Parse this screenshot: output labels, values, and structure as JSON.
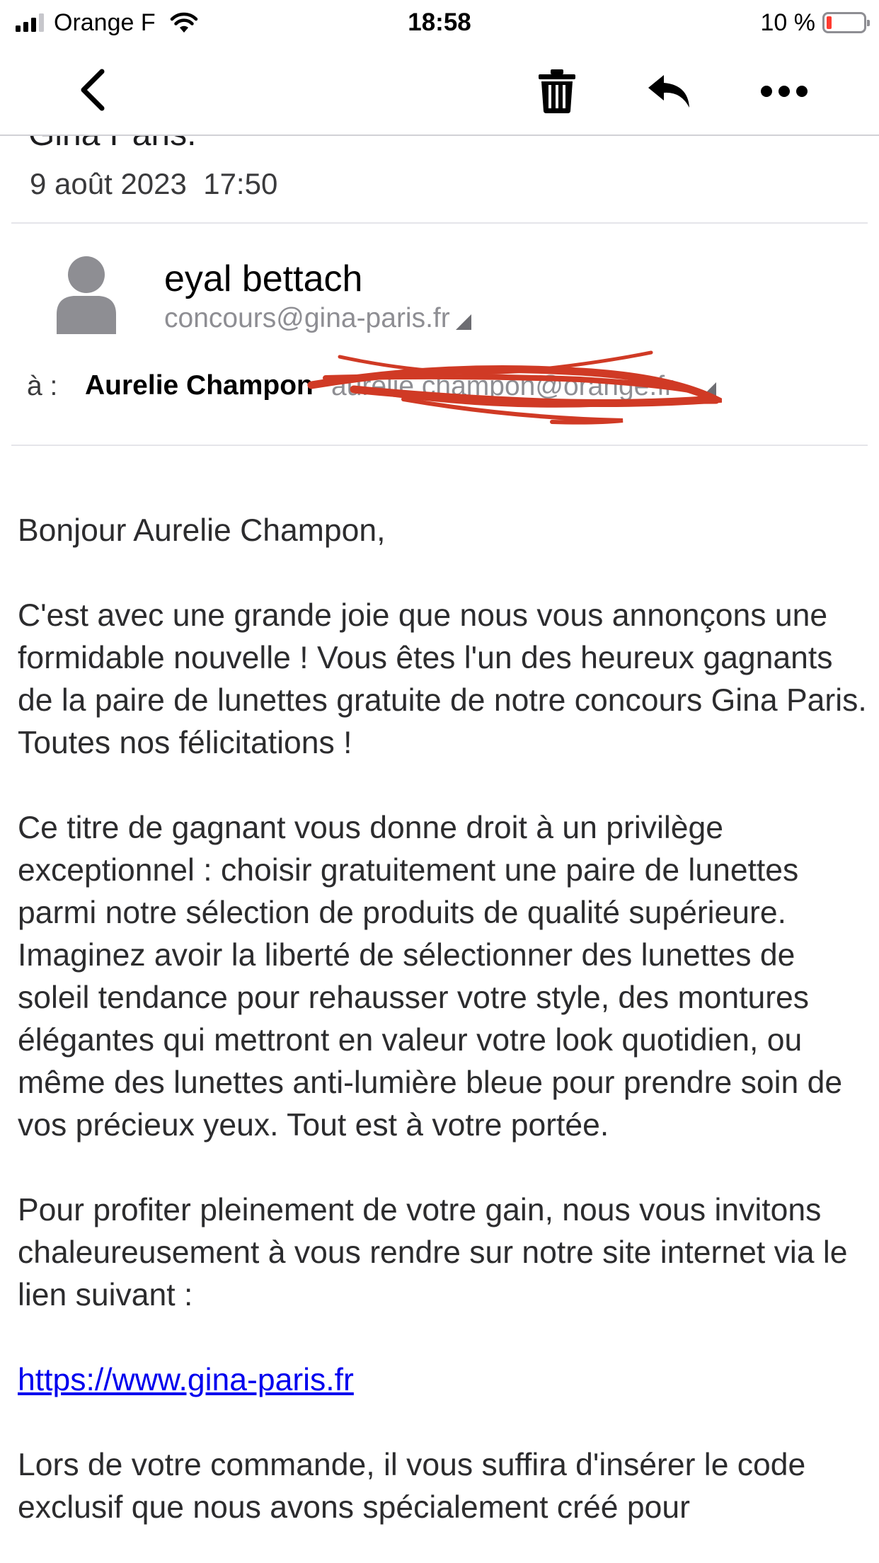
{
  "status_bar": {
    "carrier": "Orange F",
    "time": "18:58",
    "battery_percent": "10 %",
    "battery_level": 0.1,
    "signal_bars": 3,
    "signal_bars_total": 4
  },
  "toolbar": {
    "back_icon": "chevron-left-icon",
    "trash_icon": "trash-icon",
    "reply_icon": "reply-icon",
    "more_icon": "more-horizontal-icon"
  },
  "email": {
    "subject_clipped": "Gina Paris.",
    "date": "9 août 2023  17:50",
    "sender_name": "eyal bettach",
    "sender_email": "concours@gina-paris.fr",
    "to_label": "à :",
    "recipient_name": "Aurelie Champon",
    "recipient_email_redacted": "aurelie.champon@orange.fr",
    "body": {
      "greeting": "Bonjour Aurelie Champon,",
      "paragraph1": "C'est avec une grande joie que nous vous annonçons une formidable nouvelle ! Vous êtes l'un des heureux gagnants de la paire de lunettes gratuite de notre concours Gina Paris. Toutes nos félicitations !",
      "paragraph2": "Ce titre de gagnant vous donne droit à un privilège exceptionnel : choisir gratuitement une paire de lunettes parmi notre sélection de produits de qualité supérieure. Imaginez avoir la liberté de sélectionner des lunettes de soleil tendance pour rehausser votre style, des montures élégantes qui mettront en valeur votre look quotidien, ou même des lunettes anti-lumière bleue pour prendre soin de vos précieux yeux. Tout est à votre portée.",
      "paragraph3": "Pour profiter pleinement de votre gain, nous vous invitons chaleureusement à vous rendre sur notre site internet via le lien suivant :",
      "link": "https://www.gina-paris.fr",
      "paragraph4": "Lors de votre commande, il vous suffira d'insérer le code exclusif que nous avons spécialement créé pour"
    }
  },
  "colors": {
    "link": "#0000ee",
    "redaction": "#d03a25",
    "battery_low": "#ff3b30"
  }
}
